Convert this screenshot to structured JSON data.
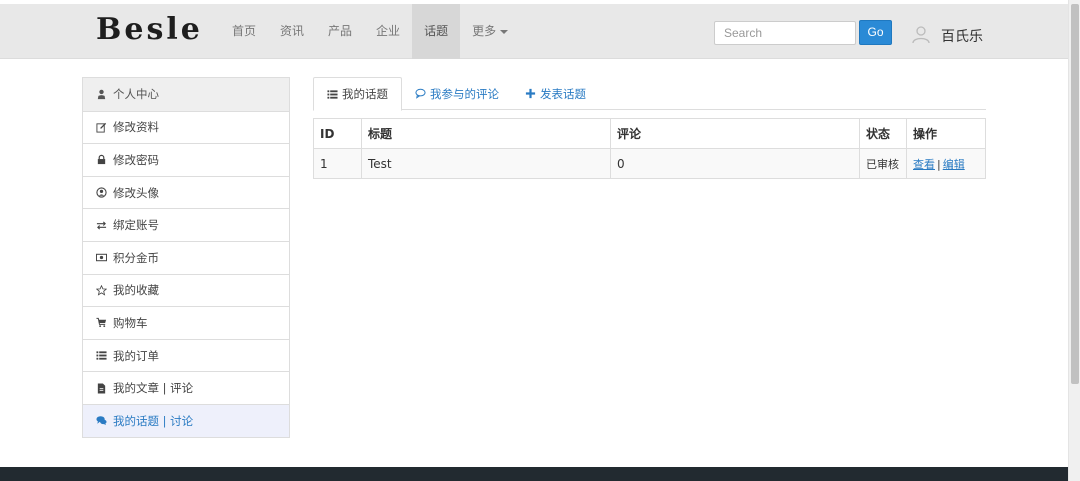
{
  "brand": {
    "logo": "Besle"
  },
  "nav": {
    "items": [
      {
        "label": "首页"
      },
      {
        "label": "资讯"
      },
      {
        "label": "产品"
      },
      {
        "label": "企业"
      },
      {
        "label": "话题",
        "active": true
      },
      {
        "label": "更多",
        "dropdown": true
      }
    ]
  },
  "search": {
    "placeholder": "Search",
    "value": "",
    "button": "Go"
  },
  "user": {
    "name": "百氏乐",
    "avatar_icon": "user-avatar-icon"
  },
  "sidebar": {
    "items": [
      {
        "label": "个人中心",
        "icon": "user-icon",
        "header": true
      },
      {
        "label": "修改资料",
        "icon": "edit-icon"
      },
      {
        "label": "修改密码",
        "icon": "lock-icon"
      },
      {
        "label": "修改头像",
        "icon": "user-circle-icon"
      },
      {
        "label": "绑定账号",
        "icon": "exchange-icon"
      },
      {
        "label": "积分金币",
        "icon": "money-icon"
      },
      {
        "label": "我的收藏",
        "icon": "star-icon"
      },
      {
        "label": "购物车",
        "icon": "cart-icon"
      },
      {
        "label": "我的订单",
        "icon": "list-icon"
      },
      {
        "label": "我的文章 | 评论",
        "icon": "file-icon"
      },
      {
        "label": "我的话题 | 讨论",
        "icon": "comments-icon",
        "active": true
      }
    ]
  },
  "tabs": [
    {
      "label": "我的话题",
      "icon": "list-icon",
      "active": true
    },
    {
      "label": "我参与的评论",
      "icon": "comment-icon"
    },
    {
      "label": "发表话题",
      "icon": "plus-icon"
    }
  ],
  "table": {
    "headers": [
      "ID",
      "标题",
      "评论",
      "状态",
      "操作"
    ],
    "rows": [
      {
        "id": "1",
        "title": "Test",
        "comments": "0",
        "status": "已审核",
        "view": "查看",
        "sep": "|",
        "edit": "编辑"
      }
    ]
  },
  "colors": {
    "accent": "#2a8ad6",
    "link": "#2a7bc3",
    "navbar_bg": "#e8e8e8",
    "footer_bg": "#222a30",
    "active_sidebar_bg": "#eef0fb"
  }
}
